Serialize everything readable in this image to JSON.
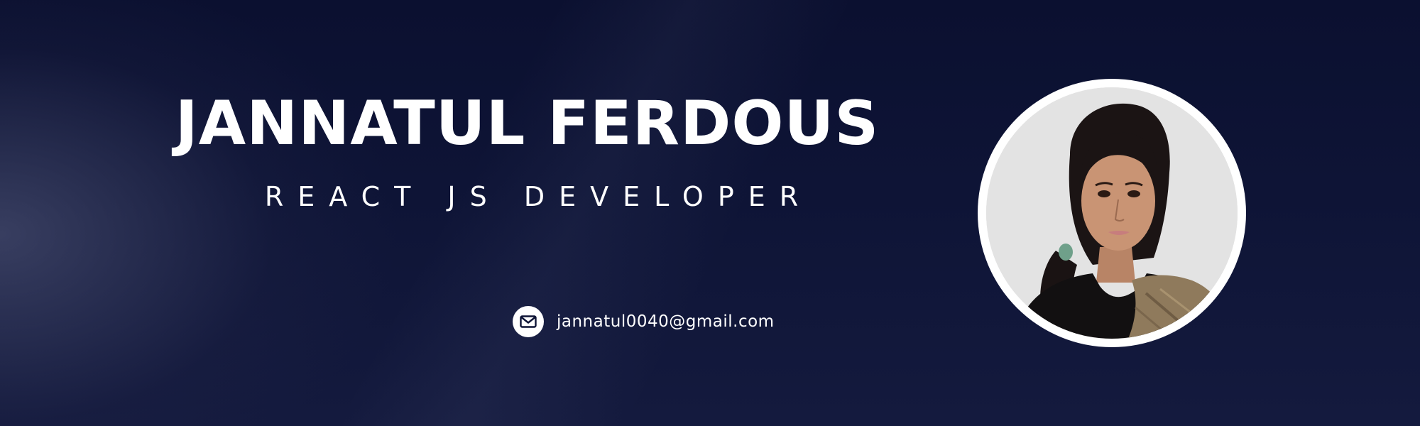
{
  "header": {
    "name": "JANNATUL FERDOUS",
    "role": "REACT JS DEVELOPER"
  },
  "contact": {
    "email": "jannatul0040@gmail.com",
    "icon": "envelope-icon"
  },
  "profile": {
    "photo": "portrait-photo"
  },
  "colors": {
    "background": "#0e1436",
    "text": "#ffffff",
    "ring": "#ffffff",
    "photo_background": "#e4e4e4"
  }
}
